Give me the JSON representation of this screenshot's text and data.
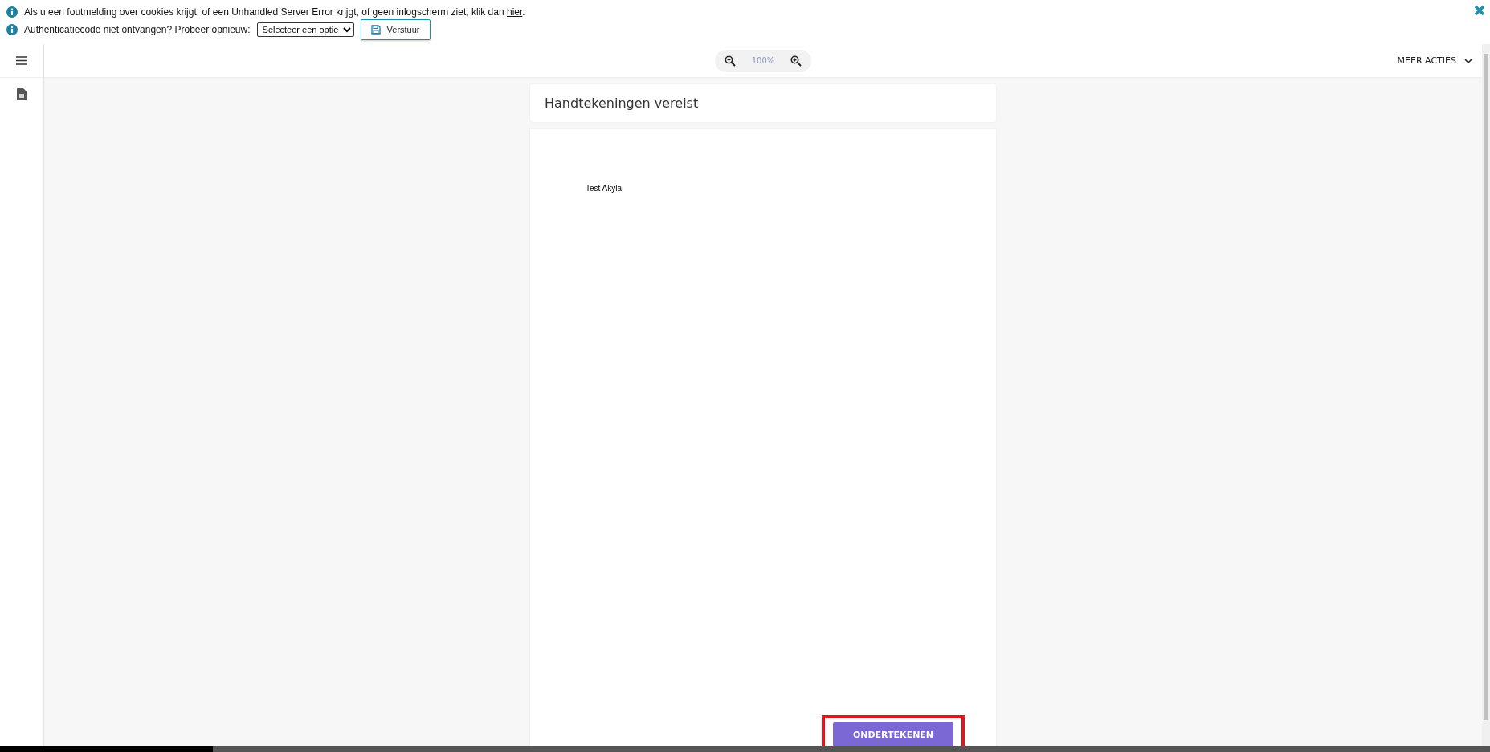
{
  "notices": [
    {
      "text": "Als u een foutmelding over cookies krijgt, of een Unhandled Server Error krijgt, of geen inlogscherm ziet, klik dan ",
      "link": "hier",
      "tail": "."
    },
    {
      "text": "Authenticatiecode niet ontvangen? Probeer opnieuw:",
      "select": "Selecteer een optie",
      "button": "Verstuur"
    }
  ],
  "toolbar": {
    "zoom": "100%",
    "actions": "MEER ACTIES"
  },
  "document": {
    "title": "Handtekeningen vereist",
    "text": "Test Akyla",
    "sign_button": "ONDERTEKENEN",
    "highlighted": true
  }
}
